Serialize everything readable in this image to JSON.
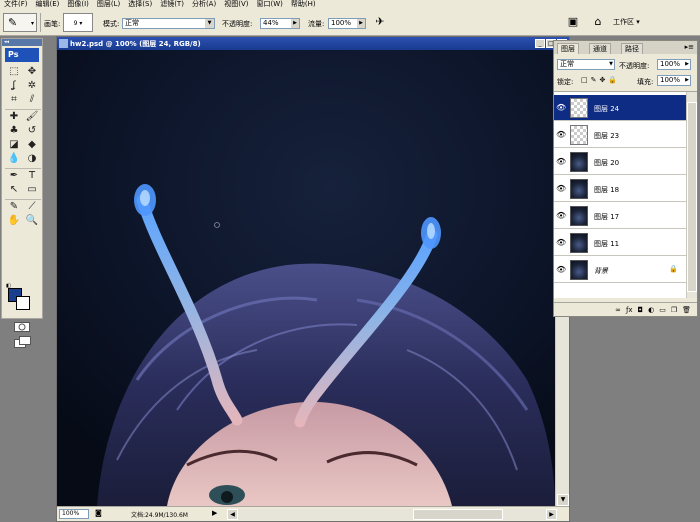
{
  "menu": [
    "文件(F)",
    "编辑(E)",
    "图像(I)",
    "图层(L)",
    "选择(S)",
    "滤镜(T)",
    "分析(A)",
    "视图(V)",
    "窗口(W)",
    "帮助(H)"
  ],
  "options": {
    "brush_label": "画笔:",
    "brush_size": "9",
    "mode_label": "模式:",
    "mode_value": "正常",
    "opacity_label": "不透明度:",
    "opacity_value": "44%",
    "flow_label": "流量:",
    "flow_value": "100%",
    "workspace_label": "工作区 ▾"
  },
  "tools": {
    "ps_logo": "Ps",
    "icons": [
      "marquee-icon",
      "move-icon",
      "lasso-icon",
      "magic-wand-icon",
      "crop-icon",
      "slice-icon",
      "healing-brush-icon",
      "brush-icon",
      "clone-stamp-icon",
      "history-brush-icon",
      "eraser-icon",
      "paint-bucket-icon",
      "blur-icon",
      "dodge-icon",
      "pen-icon",
      "type-icon",
      "path-selection-icon",
      "shape-icon",
      "notes-icon",
      "eyedropper-icon",
      "hand-icon",
      "zoom-icon"
    ],
    "glyphs": [
      "⬚",
      "✥",
      "ʆ",
      "✲",
      "⌗",
      "⫽",
      "✚",
      "🖌",
      "♣",
      "↺",
      "◪",
      "◆",
      "💧",
      "◑",
      "✒",
      "T",
      "↖",
      "▭",
      "✎",
      "⟋",
      "✋",
      "🔍"
    ]
  },
  "document": {
    "title": "hw2.psd @ 100% (图层 24, RGB/8)",
    "zoom": "100%",
    "info": "文档:24.9M/130.6M"
  },
  "layers_panel": {
    "tabs": [
      "图层",
      "通道",
      "路径"
    ],
    "blend_mode": "正常",
    "opacity_label": "不透明度:",
    "opacity_value": "100%",
    "lock_label": "锁定:",
    "fill_label": "填充:",
    "fill_value": "100%",
    "items": [
      {
        "name": "图层 24",
        "thumb": "transparent",
        "selected": true
      },
      {
        "name": "图层 23",
        "thumb": "transparent",
        "selected": false
      },
      {
        "name": "图层 20",
        "thumb": "image",
        "selected": false
      },
      {
        "name": "图层 18",
        "thumb": "image",
        "selected": false
      },
      {
        "name": "图层 17",
        "thumb": "image",
        "selected": false
      },
      {
        "name": "图层 11",
        "thumb": "image",
        "selected": false
      },
      {
        "name": "背景",
        "thumb": "image",
        "selected": false,
        "locked": true
      }
    ]
  }
}
